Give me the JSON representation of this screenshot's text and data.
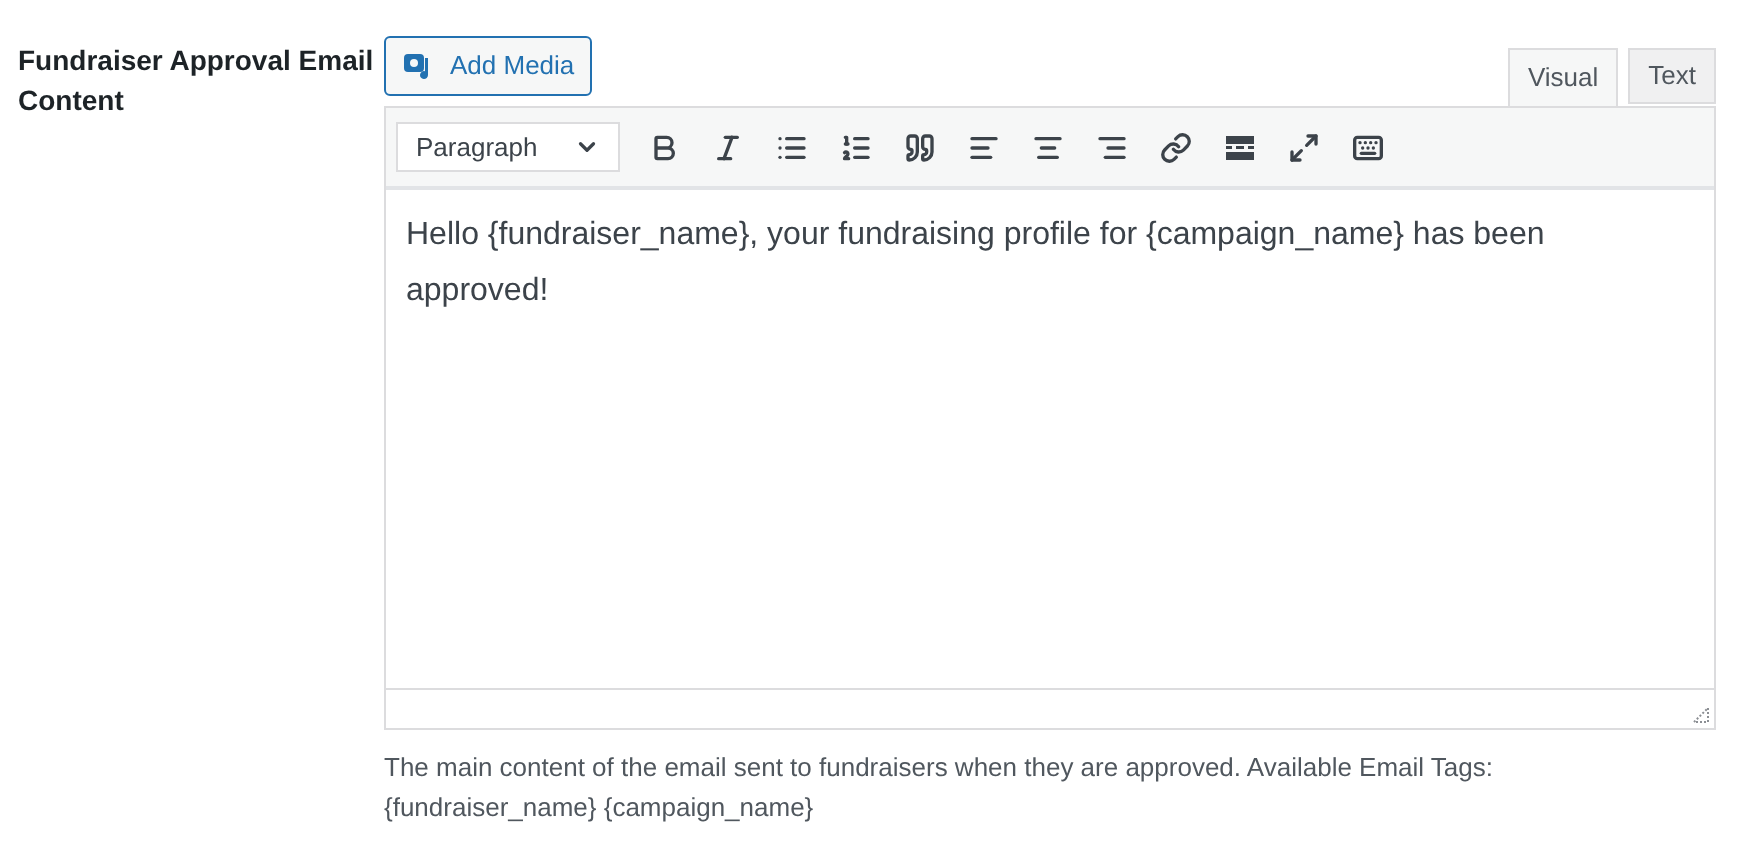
{
  "field_label": "Fundraiser Approval Email Content",
  "add_media": {
    "label": "Add Media"
  },
  "tabs": [
    {
      "label": "Visual",
      "selected": true
    },
    {
      "label": "Text",
      "selected": false
    }
  ],
  "format_select": {
    "value": "Paragraph"
  },
  "toolbar": [
    {
      "kind": "bold"
    },
    {
      "kind": "italic"
    },
    {
      "kind": "bullets"
    },
    {
      "kind": "numbers"
    },
    {
      "kind": "quote"
    },
    {
      "kind": "align-left"
    },
    {
      "kind": "align-center"
    },
    {
      "kind": "align-right"
    },
    {
      "kind": "link"
    },
    {
      "kind": "more"
    },
    {
      "kind": "fullscreen"
    },
    {
      "kind": "kitchen-sink"
    }
  ],
  "content": "Hello {fundraiser_name}, your fundraising profile for {campaign_name} has been approved!",
  "description": "The main content of the email sent to fundraisers when they are approved. Available Email Tags: {fundraiser_name} {campaign_name}"
}
